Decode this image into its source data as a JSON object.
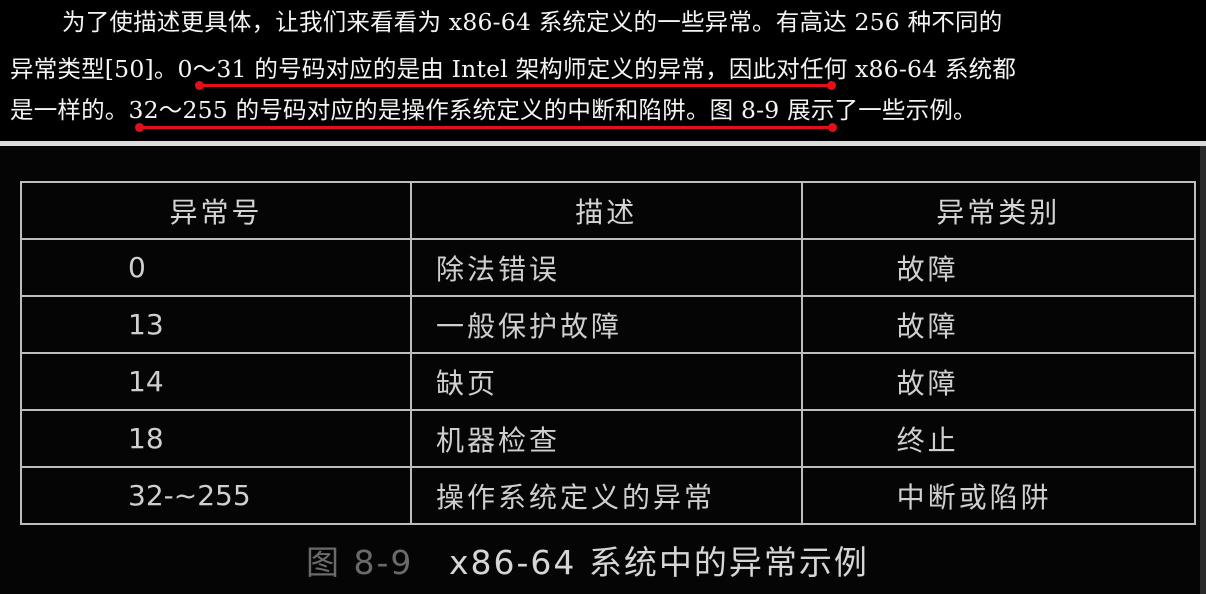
{
  "paragraph": {
    "line1": "为了使描述更具体，让我们来看看为 x86-64 系统定义的一些异常。有高达 256 种不同的",
    "line2_before": "异常类型[50]。",
    "line2_highlight": "0～31 的号码对应的是由 Intel 架构师定义的异常",
    "line2_after": "，因此对任何 x86-64 系统都",
    "line3_before": "是一样的。",
    "line3_highlight": "32～255 的号码对应的是操作系统定义的中断和陷阱",
    "line3_after": "。图 8-9 展示了一些示例。"
  },
  "highlight_color": "#e3101b",
  "table": {
    "headers": [
      "异常号",
      "描述",
      "异常类别"
    ],
    "rows": [
      [
        "0",
        "除法错误",
        "故障"
      ],
      [
        "13",
        "一般保护故障",
        "故障"
      ],
      [
        "14",
        "缺页",
        "故障"
      ],
      [
        "18",
        "机器检查",
        "终止"
      ],
      [
        "32-~255",
        "操作系统定义的异常",
        "中断或陷阱"
      ]
    ]
  },
  "caption": {
    "label": "图 8-9",
    "text": "x86-64 系统中的异常示例"
  }
}
